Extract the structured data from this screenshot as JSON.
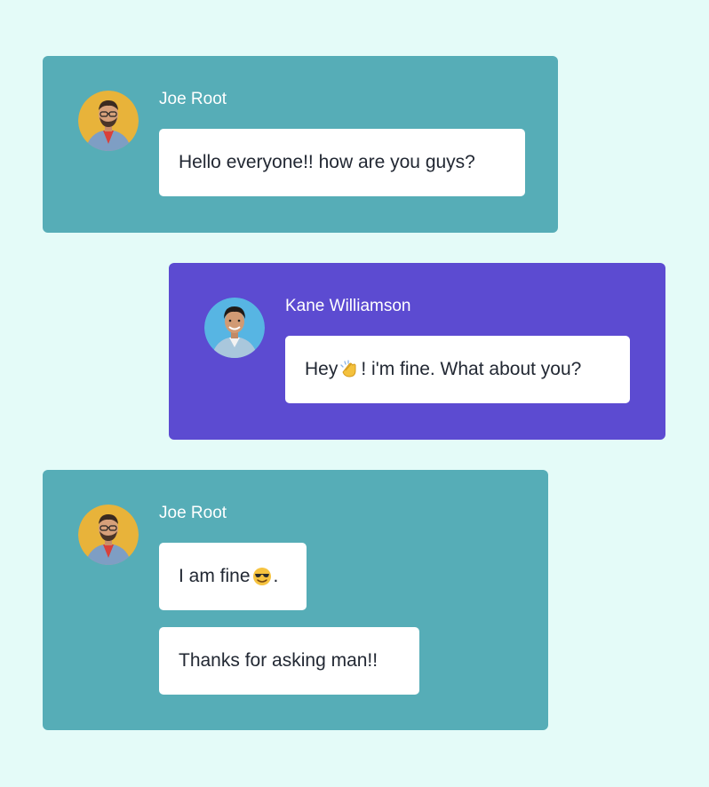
{
  "colors": {
    "page_background": "#e4fbf8",
    "card_teal": "#56adb7",
    "card_purple": "#5c4bd1",
    "bubble_background": "#ffffff",
    "bubble_text": "#222833",
    "sender_text": "#ffffff"
  },
  "messages": [
    {
      "sender": "Joe Root",
      "avatar": "avatar-joe-root",
      "card_color": "#56adb7",
      "bubbles": [
        {
          "text": "Hello everyone!! how are you guys?"
        }
      ]
    },
    {
      "sender": "Kane Williamson",
      "avatar": "avatar-kane-williamson",
      "card_color": "#5c4bd1",
      "bubbles": [
        {
          "before": "Hey",
          "emoji": "clapping-hands-emoji",
          "after": " ! i'm fine. What about you?"
        }
      ]
    },
    {
      "sender": "Joe Root",
      "avatar": "avatar-joe-root",
      "card_color": "#56adb7",
      "bubbles": [
        {
          "before": "I am fine ",
          "emoji": "sunglasses-face-emoji",
          "after": "."
        },
        {
          "text": "Thanks for asking man!!"
        }
      ]
    }
  ]
}
